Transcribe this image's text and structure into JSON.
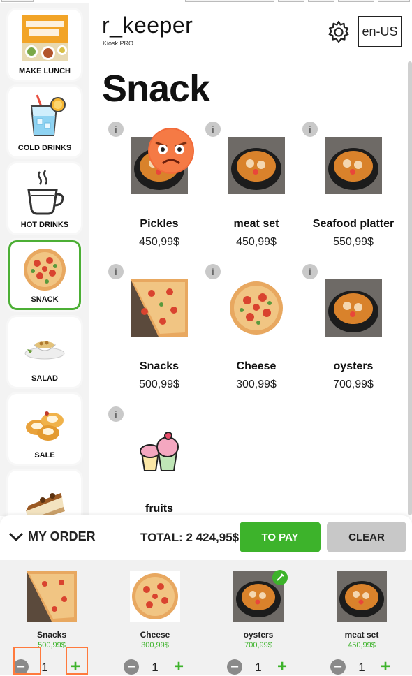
{
  "header": {
    "brand": "r_keeper",
    "brand_sub": "Kiosk PRO",
    "language": "en-US"
  },
  "page_title": "Snack",
  "sidebar": {
    "items": [
      {
        "label": "MAKE LUNCH",
        "icon": "lunch-menu-icon",
        "active": false
      },
      {
        "label": "COLD DRINKS",
        "icon": "cold-drink-icon",
        "active": false
      },
      {
        "label": "HOT DRINKS",
        "icon": "hot-drink-icon",
        "active": false
      },
      {
        "label": "SNACK",
        "icon": "pizza-icon",
        "active": true
      },
      {
        "label": "SALAD",
        "icon": "salad-icon",
        "active": false
      },
      {
        "label": "SALE",
        "icon": "pastry-icon",
        "active": false
      },
      {
        "label": "",
        "icon": "cake-slice-icon",
        "active": false
      }
    ]
  },
  "products": [
    {
      "name": "Pickles",
      "price": "450,99$",
      "image": "soup-bowl"
    },
    {
      "name": "meat set",
      "price": "450,99$",
      "image": "soup-bowl"
    },
    {
      "name": "Seafood platter",
      "price": "550,99$",
      "image": "soup-bowl"
    },
    {
      "name": "Snacks",
      "price": "500,99$",
      "image": "pizza-slices"
    },
    {
      "name": "Cheese",
      "price": "300,99$",
      "image": "pizza"
    },
    {
      "name": "oysters",
      "price": "700,99$",
      "image": "soup-bowl"
    },
    {
      "name": "fruits",
      "price": "",
      "image": "cupcake"
    }
  ],
  "order": {
    "label": "MY ORDER",
    "total": "TOTAL: 2 424,95$",
    "pay_label": "TO PAY",
    "clear_label": "CLEAR",
    "items": [
      {
        "name": "Snacks",
        "price": "500,99$",
        "qty": "1",
        "image": "pizza-slices"
      },
      {
        "name": "Cheese",
        "price": "300,99$",
        "qty": "1",
        "image": "pizza"
      },
      {
        "name": "oysters",
        "price": "700,99$",
        "qty": "1",
        "image": "soup-bowl"
      },
      {
        "name": "meat set",
        "price": "450,99$",
        "qty": "1",
        "image": "soup-bowl"
      }
    ]
  },
  "colors": {
    "accent_green": "#3db32b",
    "active_border": "#4caf35",
    "highlight_orange": "#ff7a3d"
  }
}
